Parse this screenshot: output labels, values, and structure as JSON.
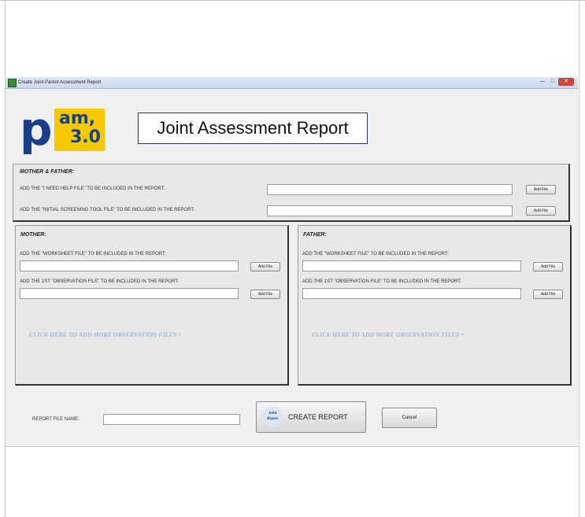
{
  "window": {
    "title": "Create Joint Parent Assessment Report",
    "minimize_glyph": "—",
    "maximize_glyph": "□",
    "close_glyph": "✕"
  },
  "logo": {
    "letter": "p",
    "text_top": "am,",
    "version": "3.0",
    "colors": {
      "blue": "#173f8c",
      "yellow": "#f5c800"
    }
  },
  "report_title": "Joint Assessment Report",
  "both": {
    "heading": "MOTHER & FATHER:",
    "rows": [
      {
        "label": "ADD THE \"I NEED HELP FILE\" TO BE INCLUDED IN THE REPORT:",
        "value": "",
        "button": "Add File"
      },
      {
        "label": "ADD THE \"INITIAL SCREENING TOOL FILE\" TO BE INCLUDED IN THE REPORT:",
        "value": "",
        "button": "Add File"
      }
    ]
  },
  "mother": {
    "heading": "MOTHER:",
    "rows": [
      {
        "label": "ADD THE \"WORKSHEET FILE\" TO BE INCLUDED IN THE REPORT:",
        "value": "",
        "button": "Add File"
      },
      {
        "label": "ADD THE 1ST \"OBSERVATION FILE\" TO BE INCLUDED IN THE REPORT:",
        "value": "",
        "button": "Add File"
      }
    ],
    "more_link": "CLICK HERE TO ADD MORE OBSERVATION FILES +"
  },
  "father": {
    "heading": "FATHER:",
    "rows": [
      {
        "label": "ADD THE \"WORKSHEET FILE\" TO BE INCLUDED IN THE REPORT:",
        "value": "",
        "button": "Add File"
      },
      {
        "label": "ADD THE 1ST \"OBSERVATION FILE\" TO BE INCLUDED IN THE REPORT:",
        "value": "",
        "button": "Add File"
      }
    ],
    "more_link": "CLICK HERE TO ADD MORE OBSERVATION FILES +"
  },
  "footer": {
    "report_file_name_label": "REPORT FILE NAME:",
    "report_file_name_value": "",
    "create_icon_line1": "Joint",
    "create_icon_line2": "Report",
    "create_button": "CREATE REPORT",
    "cancel_button": "Cancel"
  }
}
